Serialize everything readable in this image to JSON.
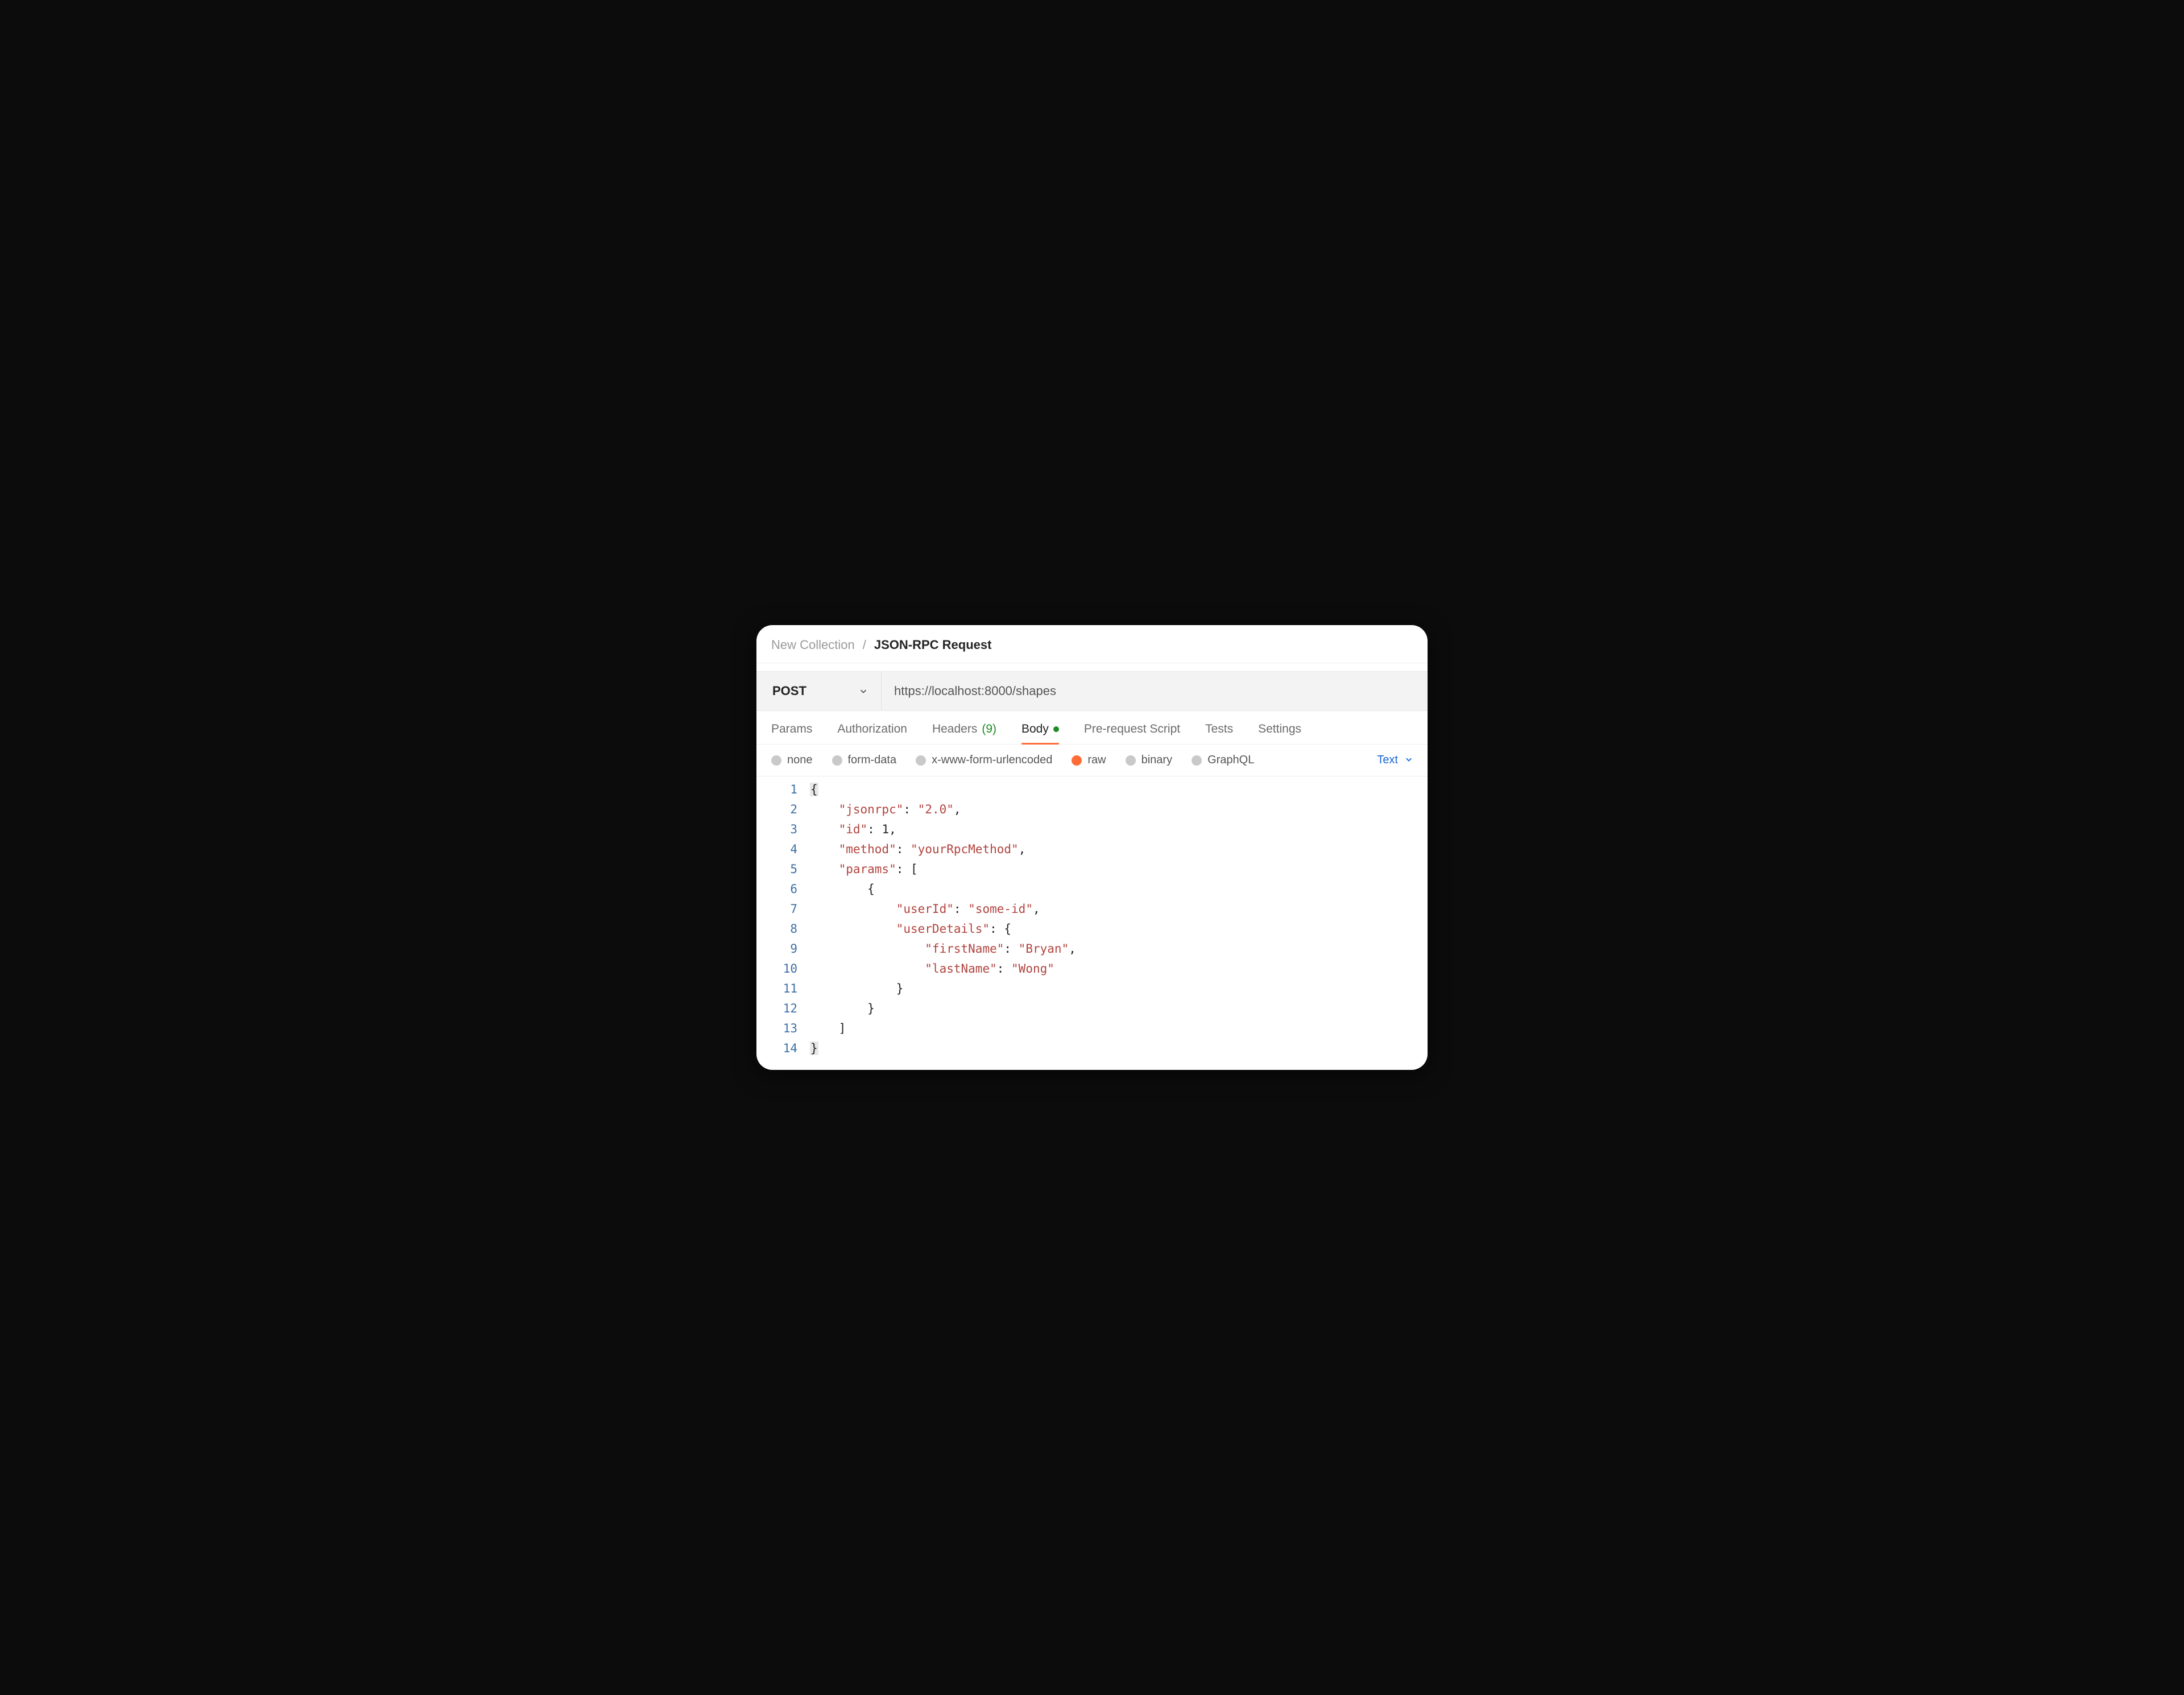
{
  "breadcrumb": {
    "collection": "New Collection",
    "separator": "/",
    "request": "JSON-RPC Request"
  },
  "request": {
    "method": "POST",
    "url": "https://localhost:8000/shapes"
  },
  "tabs": {
    "params": "Params",
    "authorization": "Authorization",
    "headers_label": "Headers",
    "headers_count": "(9)",
    "body": "Body",
    "pre_request": "Pre-request Script",
    "tests": "Tests",
    "settings": "Settings"
  },
  "body_types": {
    "none": "none",
    "form_data": "form-data",
    "urlencoded": "x-www-form-urlencoded",
    "raw": "raw",
    "binary": "binary",
    "graphql": "GraphQL"
  },
  "language_selector": "Text",
  "code_lines": [
    "{",
    "    \"jsonrpc\": \"2.0\",",
    "    \"id\": 1,",
    "    \"method\": \"yourRpcMethod\",",
    "    \"params\": [",
    "        {",
    "            \"userId\": \"some-id\",",
    "            \"userDetails\": {",
    "                \"firstName\": \"Bryan\",",
    "                \"lastName\": \"Wong\"",
    "            }",
    "        }",
    "    ]",
    "}"
  ],
  "request_body": {
    "jsonrpc": "2.0",
    "id": 1,
    "method": "yourRpcMethod",
    "params": [
      {
        "userId": "some-id",
        "userDetails": {
          "firstName": "Bryan",
          "lastName": "Wong"
        }
      }
    ]
  }
}
